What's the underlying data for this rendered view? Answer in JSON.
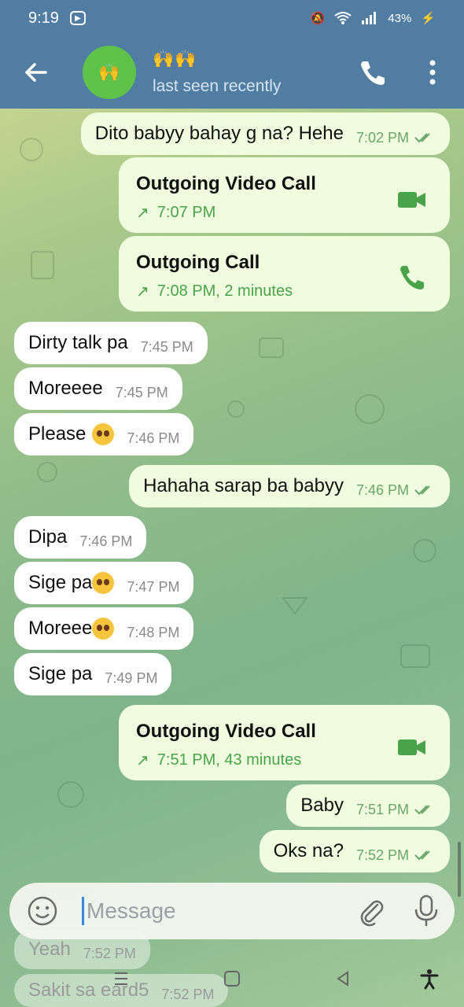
{
  "status_bar": {
    "time": "9:19",
    "battery": "43%"
  },
  "header": {
    "title": "🙌🙌",
    "subtitle": "last seen recently"
  },
  "messages": [
    {
      "dir": "out",
      "text": "Dito babyy bahay g na? Hehe",
      "time": "7:02 PM"
    },
    {
      "dir": "call",
      "title": "Outgoing Video Call",
      "info": "7:07 PM",
      "icon": "video-call-icon"
    },
    {
      "dir": "call",
      "title": "Outgoing Call",
      "info": "7:08 PM, 2 minutes",
      "icon": "phone-icon"
    },
    {
      "dir": "in",
      "text": "Dirty talk pa",
      "time": "7:45 PM"
    },
    {
      "dir": "in",
      "text": "Moreeee",
      "time": "7:45 PM"
    },
    {
      "dir": "in",
      "text": "Please",
      "time": "7:46 PM"
    },
    {
      "dir": "out",
      "text": "Hahaha sarap ba babyy",
      "time": "7:46 PM"
    },
    {
      "dir": "in",
      "text": "Dipa",
      "time": "7:46 PM"
    },
    {
      "dir": "in",
      "text": "Sige pa",
      "time": "7:47 PM"
    },
    {
      "dir": "in",
      "text": "Moreee",
      "time": "7:48 PM"
    },
    {
      "dir": "in",
      "text": "Sige pa",
      "time": "7:49 PM"
    },
    {
      "dir": "call",
      "title": "Outgoing Video Call",
      "info": "7:51 PM, 43 minutes",
      "icon": "video-call-icon"
    },
    {
      "dir": "out",
      "text": "Baby",
      "time": "7:51 PM"
    },
    {
      "dir": "out",
      "text": "Oks na?",
      "time": "7:52 PM"
    },
    {
      "dir": "ghost",
      "text": "Yeah",
      "time": "7:52 PM"
    },
    {
      "dir": "ghost",
      "text": "Sakit sa eard5",
      "time": "7:52 PM"
    }
  ],
  "input": {
    "placeholder": "Message"
  },
  "colors": {
    "header_bg": "#517da2",
    "outgoing_bubble": "#effdde",
    "incoming_bubble": "#ffffff",
    "call_accent": "#4aa24a"
  }
}
